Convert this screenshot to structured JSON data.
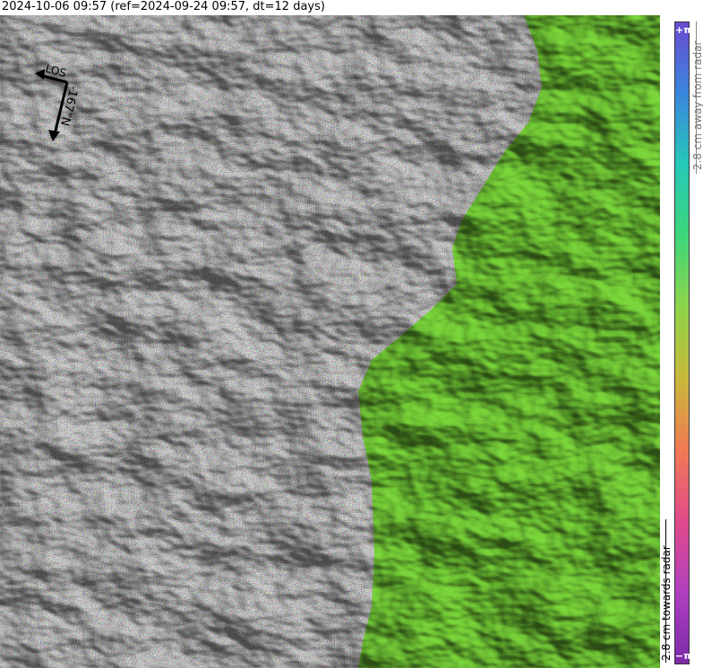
{
  "header": {
    "title": "2024-10-06 09:57 (ref=2024-09-24 09:57, dt=12 days)"
  },
  "map": {
    "los_label": "LOS",
    "heading_label": "-167°N"
  },
  "colorbar": {
    "top_symbol": "+π",
    "bottom_symbol": "−π",
    "away_label": "2.8 cm away from radar",
    "towards_label": "2.8 cm towards radar",
    "colors": [
      "#7a2aa8",
      "#b040c0",
      "#e04a8a",
      "#f07a55",
      "#c9b93a",
      "#8fd44a",
      "#3ed67a",
      "#26c8b8",
      "#3a86dc",
      "#6a4ad0"
    ]
  }
}
